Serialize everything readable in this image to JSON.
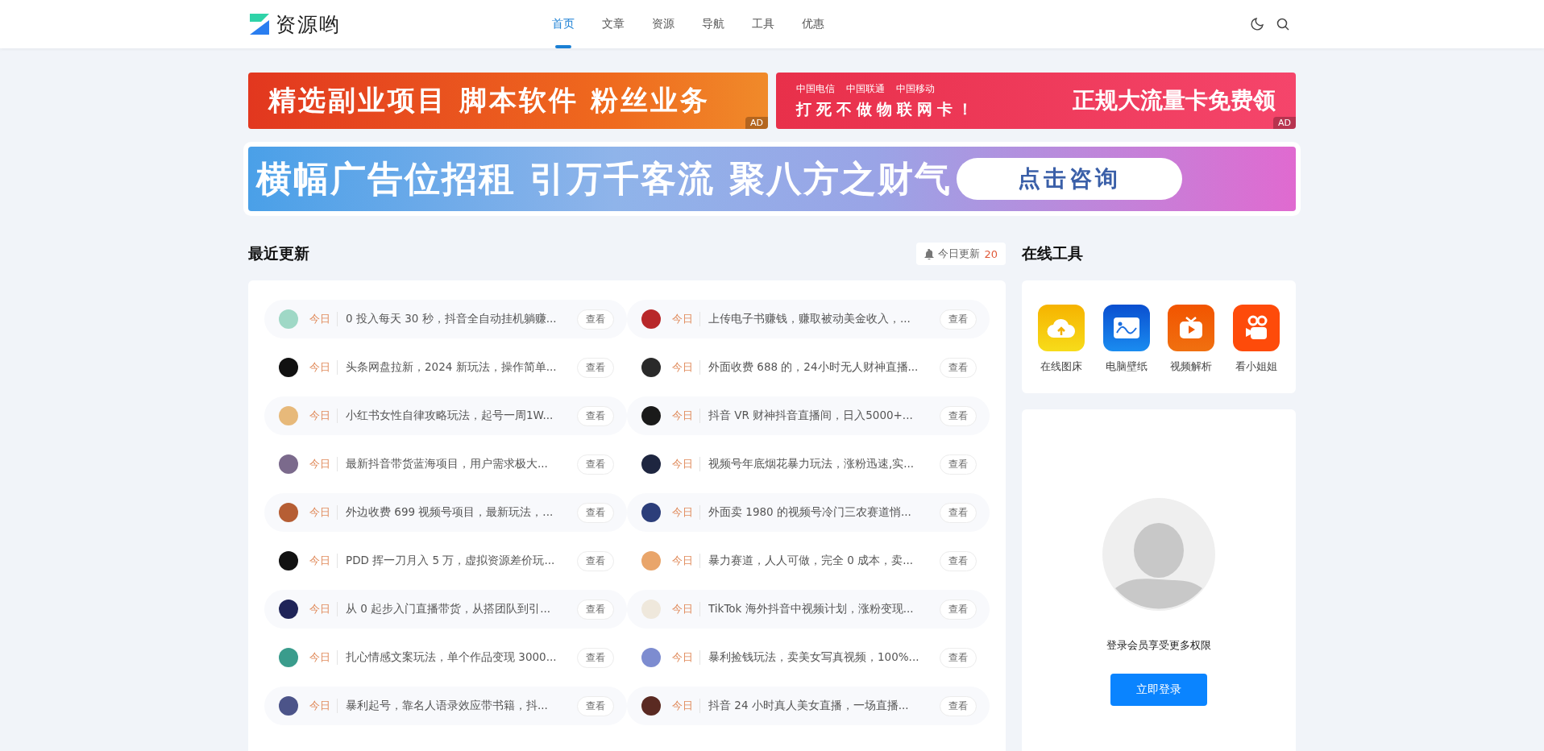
{
  "header": {
    "logo": "资源哟",
    "nav": [
      {
        "label": "首页",
        "selected": true
      },
      {
        "label": "文章",
        "selected": false
      },
      {
        "label": "资源",
        "selected": false
      },
      {
        "label": "导航",
        "selected": false
      },
      {
        "label": "工具",
        "selected": false
      },
      {
        "label": "优惠",
        "selected": false
      }
    ]
  },
  "ads": [
    {
      "kind": "orange",
      "text": "精选副业项目 脚本软件 粉丝业务",
      "badge": "AD"
    },
    {
      "kind": "carrier",
      "carriers": [
        "中国电信",
        "中国联通",
        "中国移动"
      ],
      "slogan": "打死不做物联网卡！",
      "text": "正规大流量卡免费领",
      "badge": "AD"
    }
  ],
  "banner": {
    "text": "横幅广告位招租 引万千客流 聚八方之财气",
    "button": "点击咨询"
  },
  "recent": {
    "title": "最近更新",
    "badge": {
      "label": "今日更新",
      "count": "20"
    },
    "items": [
      {
        "tag": "今日",
        "title": "0 投入每天 30 秒，抖音全自动挂机躺赚...",
        "action": "查看",
        "color": "#9fd8c6"
      },
      {
        "tag": "今日",
        "title": "上传电子书赚钱，赚取被动美金收入，...",
        "action": "查看",
        "color": "#b8282a"
      },
      {
        "tag": "今日",
        "title": "头条网盘拉新，2024 新玩法，操作简单...",
        "action": "查看",
        "color": "#111111"
      },
      {
        "tag": "今日",
        "title": "外面收费 688 的，24小时无人财神直播...",
        "action": "查看",
        "color": "#2a2a2a"
      },
      {
        "tag": "今日",
        "title": "小红书女性自律攻略玩法，起号一周1W...",
        "action": "查看",
        "color": "#e7b97a"
      },
      {
        "tag": "今日",
        "title": "抖音 VR 财神抖音直播间，日入5000+...",
        "action": "查看",
        "color": "#1a1a1a"
      },
      {
        "tag": "今日",
        "title": "最新抖音带货蓝海项目，用户需求极大...",
        "action": "查看",
        "color": "#7b6a8c"
      },
      {
        "tag": "今日",
        "title": "视频号年底烟花暴力玩法，涨粉迅速,实...",
        "action": "查看",
        "color": "#1e2640"
      },
      {
        "tag": "今日",
        "title": "外边收费 699 视频号项目，最新玩法，...",
        "action": "查看",
        "color": "#b65e34"
      },
      {
        "tag": "今日",
        "title": "外面卖 1980 的视频号冷门三农赛道悄...",
        "action": "查看",
        "color": "#2c3e7a"
      },
      {
        "tag": "今日",
        "title": "PDD 挥一刀月入 5 万，虚拟资源差价玩...",
        "action": "查看",
        "color": "#121212"
      },
      {
        "tag": "今日",
        "title": "暴力赛道，人人可做，完全 0 成本，卖...",
        "action": "查看",
        "color": "#e9a56a"
      },
      {
        "tag": "今日",
        "title": "从 0 起步入门直播带货，从搭团队到引...",
        "action": "查看",
        "color": "#1f2458"
      },
      {
        "tag": "今日",
        "title": "TikTok 海外抖音中视频计划，涨粉变现...",
        "action": "查看",
        "color": "#efe8dc"
      },
      {
        "tag": "今日",
        "title": "扎心情感文案玩法，单个作品变现 3000...",
        "action": "查看",
        "color": "#3a9c8c"
      },
      {
        "tag": "今日",
        "title": "暴利捡钱玩法，卖美女写真视频，100%...",
        "action": "查看",
        "color": "#7d8cd0"
      },
      {
        "tag": "今日",
        "title": "暴利起号，靠名人语录效应带书籍，抖...",
        "action": "查看",
        "color": "#4c5489"
      },
      {
        "tag": "今日",
        "title": "抖音 24 小时真人美女直播，一场直播...",
        "action": "查看",
        "color": "#5a2a22"
      }
    ]
  },
  "tools": {
    "title": "在线工具",
    "items": [
      {
        "kind": "cloud",
        "label": "在线图床"
      },
      {
        "kind": "image",
        "label": "电脑壁纸"
      },
      {
        "kind": "tv",
        "label": "视频解析"
      },
      {
        "kind": "camera",
        "label": "看小姐姐"
      }
    ]
  },
  "login": {
    "text": "登录会员享受更多权限",
    "button": "立即登录"
  }
}
